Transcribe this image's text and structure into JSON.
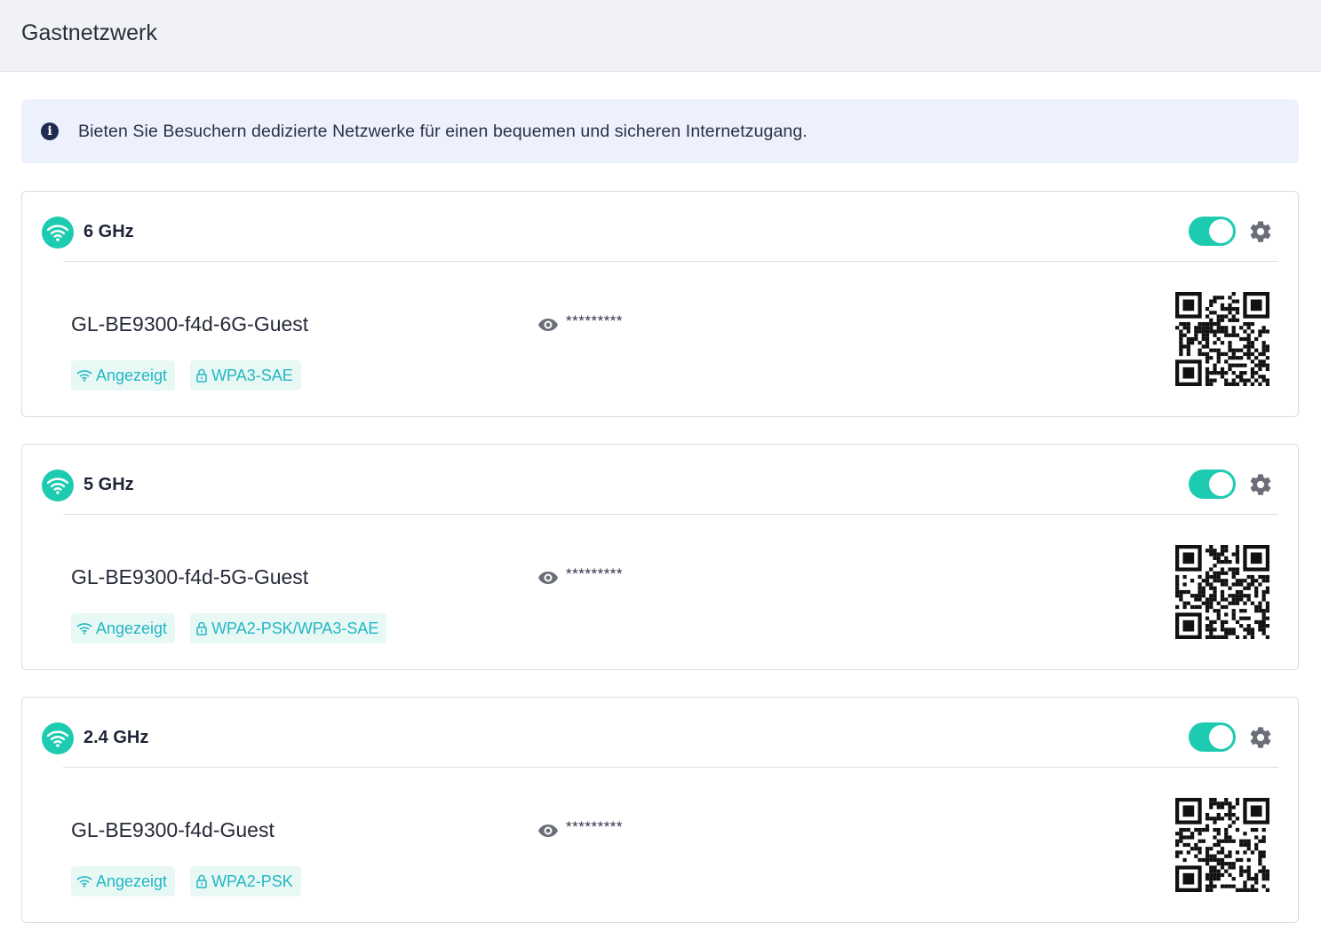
{
  "header": {
    "title": "Gastnetzwerk"
  },
  "info": {
    "text": "Bieten Sie Besuchern dedizierte Netzwerke für einen bequemen und sicheren Internetzugang."
  },
  "colors": {
    "accent": "#1ccbb0",
    "tag_text": "#22b7c3",
    "tag_bg": "#e8f8f5",
    "info_bg": "#edf1fd"
  },
  "networks": [
    {
      "band": "6 GHz",
      "enabled": true,
      "ssid": "GL-BE9300-f4d-6G-Guest",
      "password_masked": "*********",
      "broadcast_tag": "Angezeigt",
      "security_tag": "WPA3-SAE"
    },
    {
      "band": "5 GHz",
      "enabled": true,
      "ssid": "GL-BE9300-f4d-5G-Guest",
      "password_masked": "*********",
      "broadcast_tag": "Angezeigt",
      "security_tag": "WPA2-PSK/WPA3-SAE"
    },
    {
      "band": "2.4 GHz",
      "enabled": true,
      "ssid": "GL-BE9300-f4d-Guest",
      "password_masked": "*********",
      "broadcast_tag": "Angezeigt",
      "security_tag": "WPA2-PSK"
    }
  ]
}
